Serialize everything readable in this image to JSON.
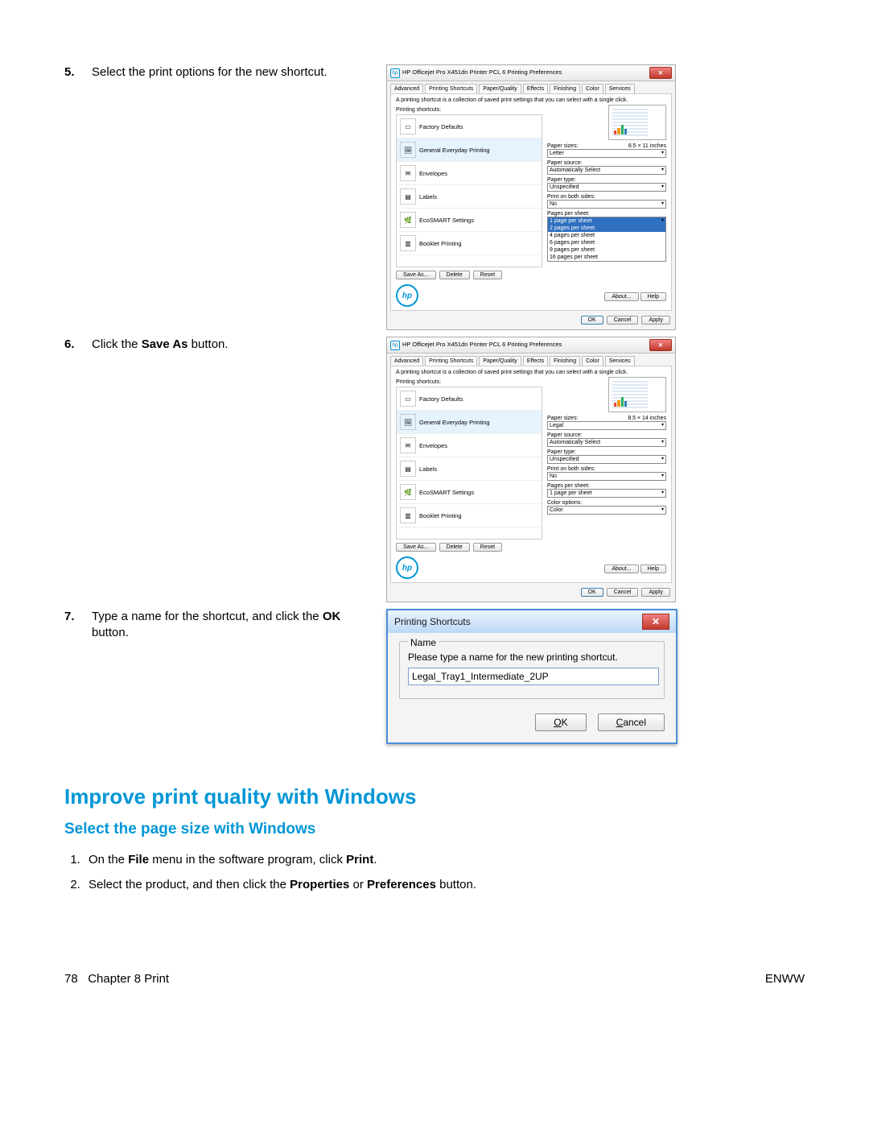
{
  "steps": {
    "s5": {
      "num": "5.",
      "text_before": "Select the print options for the new shortcut."
    },
    "s6": {
      "num": "6.",
      "text_pre": "Click the ",
      "bold": "Save As",
      "text_post": " button."
    },
    "s7": {
      "num": "7.",
      "text_pre": "Type a name for the shortcut, and click the ",
      "bold": "OK",
      "text_post": " button."
    }
  },
  "dlg1": {
    "title": "HP Officejet Pro X451dn Printer PCL 6 Printing Preferences",
    "tabs": [
      "Advanced",
      "Printing Shortcuts",
      "Paper/Quality",
      "Effects",
      "Finishing",
      "Color",
      "Services"
    ],
    "desc": "A printing shortcut is a collection of saved print settings that you can select with a single click.",
    "list_label": "Printing shortcuts:",
    "shortcuts": [
      "Factory Defaults",
      "General Everyday Printing",
      "Envelopes",
      "Labels",
      "EcoSMART Settings",
      "Booklet Printing"
    ],
    "buttons": {
      "save_as": "Save As...",
      "delete": "Delete",
      "reset": "Reset"
    },
    "right": {
      "paper_sizes_lbl": "Paper sizes:",
      "paper_sizes_dim": "8.5 × 11 inches",
      "paper_sizes_val": "Letter",
      "paper_source_lbl": "Paper source:",
      "paper_source_val": "Automatically Select",
      "paper_type_lbl": "Paper type:",
      "paper_type_val": "Unspecified",
      "both_sides_lbl": "Print on both sides:",
      "both_sides_val": "No",
      "ppg_lbl": "Pages per sheet:",
      "ppg_sel": "1 page per sheet",
      "ppg_opts": [
        "1 page per sheet",
        "2 pages per sheet",
        "4 pages per sheet",
        "6 pages per sheet",
        "9 pages per sheet",
        "16 pages per sheet"
      ]
    },
    "footer_btns": {
      "about": "About...",
      "help": "Help"
    },
    "dlg_btns": {
      "ok": "OK",
      "cancel": "Cancel",
      "apply": "Apply"
    }
  },
  "dlg2": {
    "title": "HP Officejet Pro X451dn Printer PCL 6 Printing Preferences",
    "tabs": [
      "Advanced",
      "Printing Shortcuts",
      "Paper/Quality",
      "Effects",
      "Finishing",
      "Color",
      "Services"
    ],
    "desc": "A printing shortcut is a collection of saved print settings that you can select with a single click.",
    "list_label": "Printing shortcuts:",
    "shortcuts": [
      "Factory Defaults",
      "General Everyday Printing",
      "Envelopes",
      "Labels",
      "EcoSMART Settings",
      "Booklet Printing"
    ],
    "buttons": {
      "save_as": "Save As...",
      "delete": "Delete",
      "reset": "Reset"
    },
    "right": {
      "paper_sizes_lbl": "Paper sizes:",
      "paper_sizes_dim": "8.5 × 14 inches",
      "paper_sizes_val": "Legal",
      "paper_source_lbl": "Paper source:",
      "paper_source_val": "Automatically Select",
      "paper_type_lbl": "Paper type:",
      "paper_type_val": "Unspecified",
      "both_sides_lbl": "Print on both sides:",
      "both_sides_val": "No",
      "ppg_lbl": "Pages per sheet:",
      "ppg_val": "1 page per sheet",
      "color_lbl": "Color options:",
      "color_val": "Color"
    },
    "footer_btns": {
      "about": "About...",
      "help": "Help"
    },
    "dlg_btns": {
      "ok": "OK",
      "cancel": "Cancel",
      "apply": "Apply"
    }
  },
  "dlg3": {
    "title": "Printing Shortcuts",
    "legend": "Name",
    "prompt": "Please type a name for the new printing shortcut.",
    "value": "Legal_Tray1_Intermediate_2UP",
    "ok": "OK",
    "ok_u": "O",
    "cancel": "Cancel",
    "cancel_u": "C"
  },
  "h2": "Improve print quality with Windows",
  "h3": "Select the page size with Windows",
  "bottom_steps": {
    "s1": {
      "p1": "On the ",
      "b1": "File",
      "p2": " menu in the software program, click ",
      "b2": "Print",
      "p3": "."
    },
    "s2": {
      "p1": "Select the product, and then click the ",
      "b1": "Properties",
      "p2": " or ",
      "b2": "Preferences",
      "p3": " button."
    }
  },
  "footer": {
    "page": "78",
    "chapter": "Chapter 8   Print",
    "right": "ENWW"
  }
}
